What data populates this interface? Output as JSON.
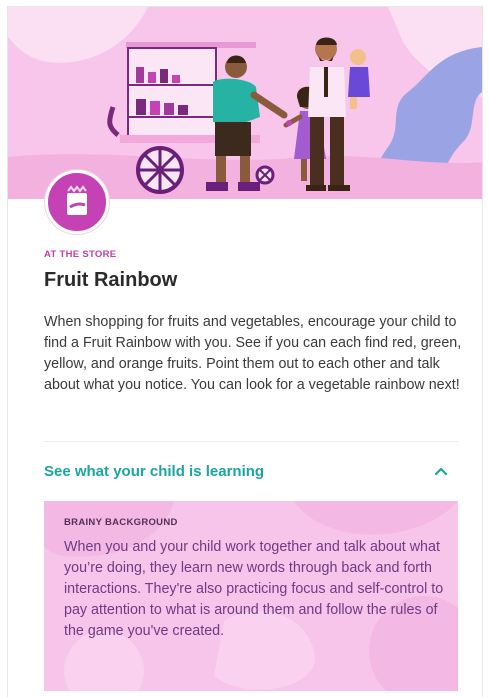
{
  "activity": {
    "category": "AT THE STORE",
    "title": "Fruit Rainbow",
    "description": "When shopping for fruits and vegetables, encourage your child to find a Fruit Rainbow with you. See if you can each find red, green, yellow, and orange fruits. Point them out to each other and talk about what you notice. You can look for a vegetable rainbow next!",
    "badge_icon": "shopping-bag-icon"
  },
  "learning": {
    "toggle_label": "See what your child is learning",
    "expanded": true,
    "panel_heading": "BRAINY BACKGROUND",
    "panel_text": "When you and your child work together and talk about what you’re doing, they learn new words through back and forth interactions. They're also practicing focus and self-control to pay attention to what is around them and follow the rules of the game you've created."
  },
  "colors": {
    "accent_magenta": "#c140a5",
    "accent_teal": "#1aa6a0",
    "panel_pink": "#f7c4ea",
    "panel_text": "#6d3c83"
  }
}
